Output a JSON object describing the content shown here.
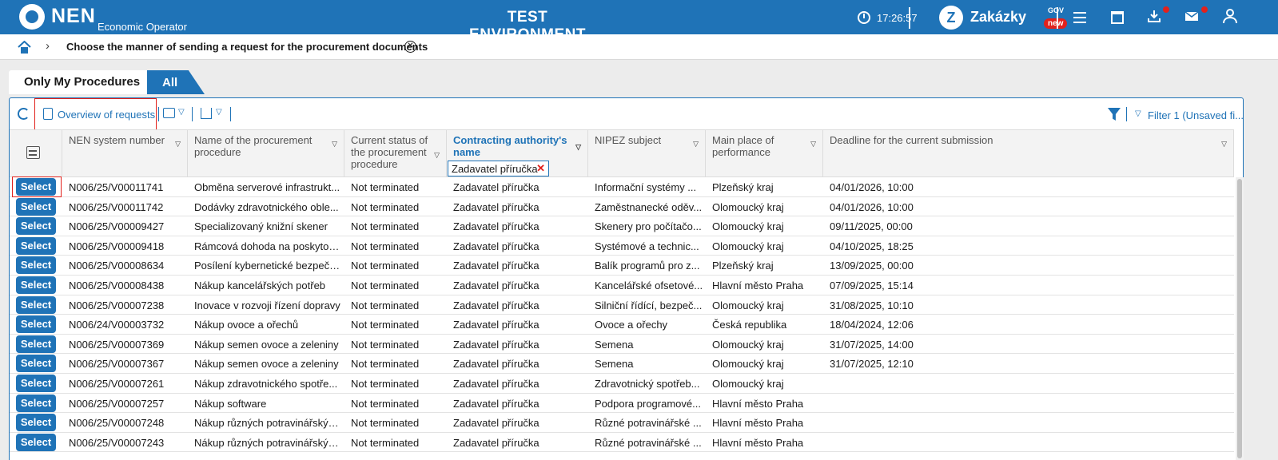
{
  "header": {
    "logo_text": "NEN",
    "logo_sub": "Economic Operator",
    "env_title": "TEST ENVIRONMENT",
    "time": "17:26:57",
    "zakazky": "Zakázky",
    "gov": "GOV",
    "new_badge": "new"
  },
  "breadcrumb": {
    "title": "Choose the manner of sending a request for the procurement documents"
  },
  "tabs": [
    "Only My Procedures",
    "All"
  ],
  "toolbar": {
    "overview_label": "Overview of requests",
    "filter_label": "Filter 1 (Unsaved fi..."
  },
  "table": {
    "columns": [
      "NEN system number",
      "Name of the procurement procedure",
      "Current status of the procurement procedure",
      "Contracting authority's name",
      "NIPEZ subject",
      "Main place of performance",
      "Deadline for the current submission"
    ],
    "filter_chip": "Zadavatel příručka",
    "select_label": "Select",
    "rows": [
      [
        "N006/25/V00011741",
        "Obměna serverové infrastrukt...",
        "Not terminated",
        "Zadavatel příručka",
        "Informační systémy ...",
        "Plzeňský kraj",
        "04/01/2026, 10:00"
      ],
      [
        "N006/25/V00011742",
        "Dodávky zdravotnického oble...",
        "Not terminated",
        "Zadavatel příručka",
        "Zaměstnanecké oděv...",
        "Olomoucký kraj",
        "04/01/2026, 10:00"
      ],
      [
        "N006/25/V00009427",
        "Specializovaný knižní skener",
        "Not terminated",
        "Zadavatel příručka",
        "Skenery pro počítačo...",
        "Olomoucký kraj",
        "09/11/2025, 00:00"
      ],
      [
        "N006/25/V00009418",
        "Rámcová dohoda na poskytov...",
        "Not terminated",
        "Zadavatel příručka",
        "Systémové a technic...",
        "Olomoucký kraj",
        "04/10/2025, 18:25"
      ],
      [
        "N006/25/V00008634",
        "Posílení kybernetické bezpečn...",
        "Not terminated",
        "Zadavatel příručka",
        "Balík programů pro z...",
        "Plzeňský kraj",
        "13/09/2025, 00:00"
      ],
      [
        "N006/25/V00008438",
        "Nákup kancelářských potřeb",
        "Not terminated",
        "Zadavatel příručka",
        "Kancelářské ofsetové...",
        "Hlavní město Praha",
        "07/09/2025, 15:14"
      ],
      [
        "N006/25/V00007238",
        "Inovace v rozvoji řízení dopravy",
        "Not terminated",
        "Zadavatel příručka",
        "Silniční řídící, bezpeč...",
        "Olomoucký kraj",
        "31/08/2025, 10:10"
      ],
      [
        "N006/24/V00003732",
        "Nákup ovoce a ořechů",
        "Not terminated",
        "Zadavatel příručka",
        "Ovoce a ořechy",
        "Česká republika",
        "18/04/2024, 12:06"
      ],
      [
        "N006/25/V00007369",
        "Nákup semen ovoce a zeleniny",
        "Not terminated",
        "Zadavatel příručka",
        "Semena",
        "Olomoucký kraj",
        "31/07/2025, 14:00"
      ],
      [
        "N006/25/V00007367",
        "Nákup semen ovoce a zeleniny",
        "Not terminated",
        "Zadavatel příručka",
        "Semena",
        "Olomoucký kraj",
        "31/07/2025, 12:10"
      ],
      [
        "N006/25/V00007261",
        "Nákup zdravotnického spotře...",
        "Not terminated",
        "Zadavatel příručka",
        "Zdravotnický spotřeb...",
        "Olomoucký kraj",
        ""
      ],
      [
        "N006/25/V00007257",
        "Nákup software",
        "Not terminated",
        "Zadavatel příručka",
        "Podpora programové...",
        "Hlavní město Praha",
        ""
      ],
      [
        "N006/25/V00007248",
        "Nákup různých potravinářskýc...",
        "Not terminated",
        "Zadavatel příručka",
        "Různé potravinářské ...",
        "Hlavní město Praha",
        ""
      ],
      [
        "N006/25/V00007243",
        "Nákup různých potravinářskýc...",
        "Not terminated",
        "Zadavatel příručka",
        "Různé potravinářské ...",
        "Hlavní město Praha",
        ""
      ]
    ]
  }
}
